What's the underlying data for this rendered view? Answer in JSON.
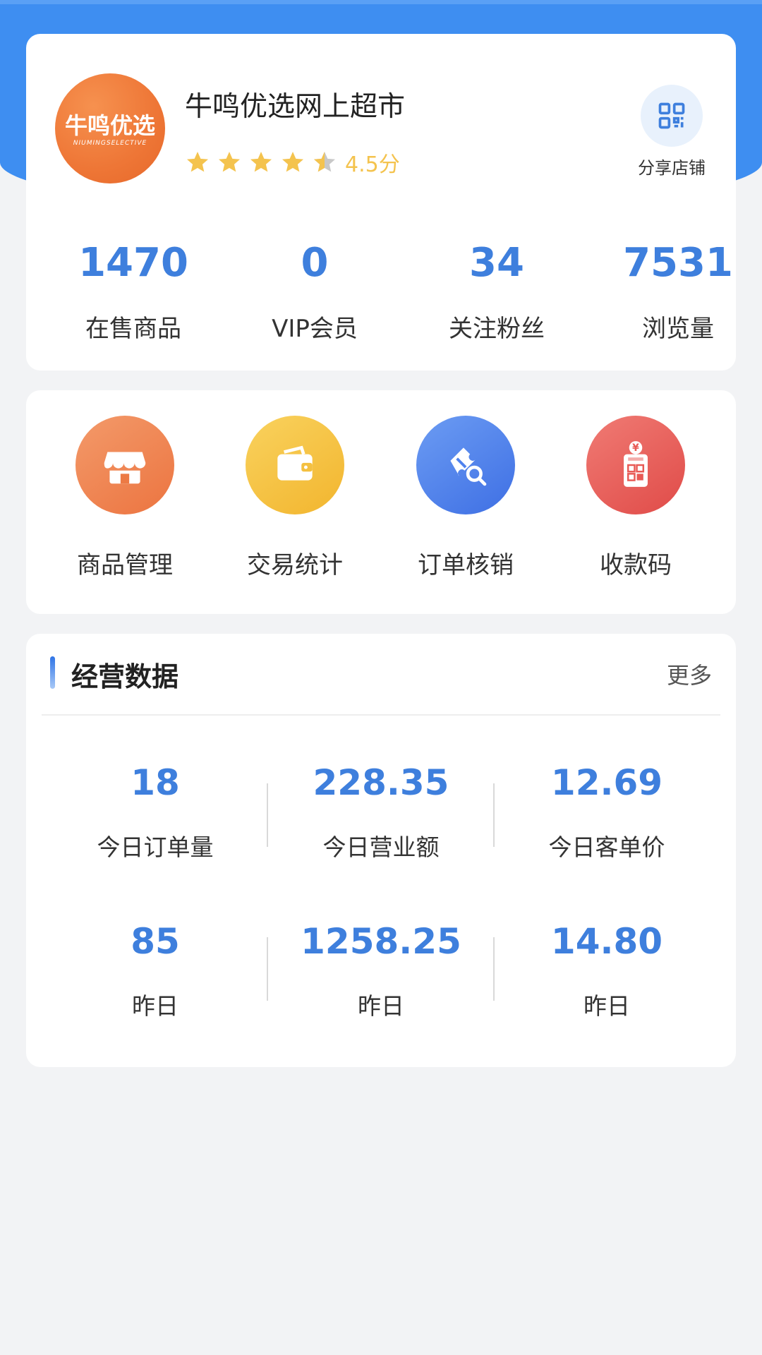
{
  "store": {
    "logo_text": "牛鸣优选",
    "logo_subtext": "NIUMINGSELECTIVE",
    "name": "牛鸣优选网上超市",
    "rating": 4.5,
    "rating_text": "4.5分",
    "share_label": "分享店铺",
    "stats": [
      {
        "value": "1470",
        "label": "在售商品"
      },
      {
        "value": "0",
        "label": "VIP会员"
      },
      {
        "value": "34",
        "label": "关注粉丝"
      },
      {
        "value": "7531",
        "label": "浏览量"
      }
    ]
  },
  "actions": [
    {
      "label": "商品管理",
      "icon": "store-icon",
      "color": "#ee7a45"
    },
    {
      "label": "交易统计",
      "icon": "wallet-icon",
      "color": "#f6c443"
    },
    {
      "label": "订单核销",
      "icon": "ticket-search-icon",
      "color": "#4f82ee"
    },
    {
      "label": "收款码",
      "icon": "payment-qr-icon",
      "color": "#e85a55"
    }
  ],
  "business": {
    "title": "经营数据",
    "more": "更多",
    "today": [
      {
        "value": "18",
        "label": "今日订单量"
      },
      {
        "value": "228.35",
        "label": "今日营业额"
      },
      {
        "value": "12.69",
        "label": "今日客单价"
      }
    ],
    "yesterday": [
      {
        "value": "85",
        "label": "昨日"
      },
      {
        "value": "1258.25",
        "label": "昨日"
      },
      {
        "value": "14.80",
        "label": "昨日"
      }
    ]
  },
  "colors": {
    "primary": "#3e8ef1",
    "number": "#3e7fdd",
    "star": "#f4c34e"
  }
}
